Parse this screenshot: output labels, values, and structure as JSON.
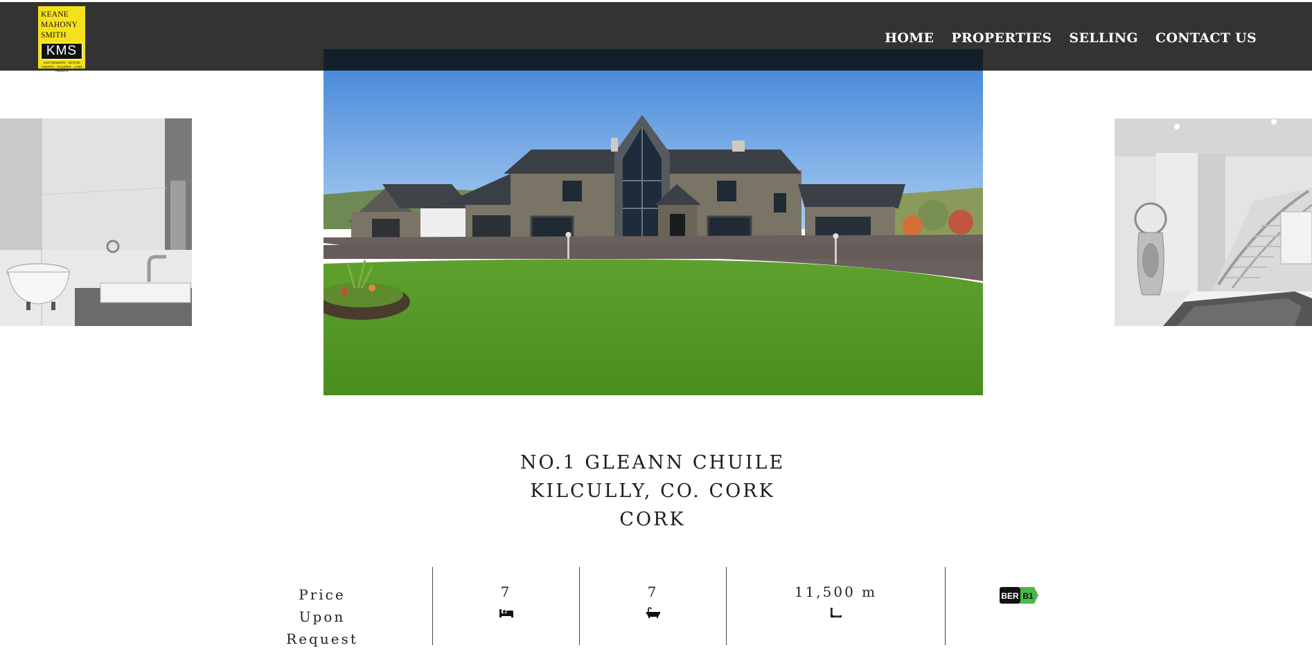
{
  "brand": {
    "logo_lines": [
      "KEANE",
      "MAHONY",
      "SMITH"
    ],
    "logo_mark": "KMS",
    "logo_tagline": "AUCTIONEERS · ESTATE AGENTS · VALUERS · LAND AGENTS",
    "colors": {
      "logo_bg": "#f5e11a",
      "header_bg": "#333333"
    }
  },
  "nav": {
    "items": [
      {
        "label": "HOME"
      },
      {
        "label": "PROPERTIES"
      },
      {
        "label": "SELLING"
      },
      {
        "label": "CONTACT US"
      }
    ]
  },
  "gallery": {
    "prev_image": "bathroom-photo",
    "main_image": "house-exterior-photo",
    "next_image": "hallway-staircase-photo"
  },
  "property": {
    "address_lines": [
      "NO.1 GLEANN CHUILE",
      "KILCULLY, CO. CORK",
      "CORK"
    ]
  },
  "stats": {
    "price_lines": [
      "Price",
      "Upon",
      "Request"
    ],
    "bedrooms": "7",
    "bedroom_icon": "bed-icon",
    "bathrooms": "7",
    "bathroom_icon": "bath-icon",
    "size": "11,500 m",
    "size_icon": "area-icon",
    "ber_label": "BER",
    "ber_rating": "B1",
    "ber_color": "#4cb848"
  }
}
